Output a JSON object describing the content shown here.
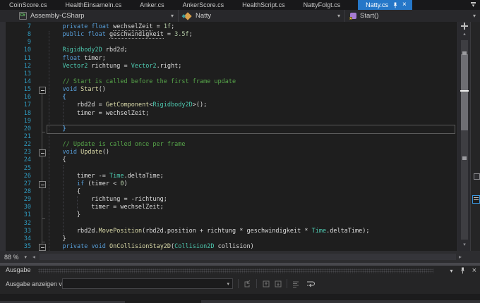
{
  "tabs": {
    "items": [
      {
        "label": "CoinScore.cs",
        "active": false
      },
      {
        "label": "HealthEinsameln.cs",
        "active": false
      },
      {
        "label": "Anker.cs",
        "active": false
      },
      {
        "label": "AnkerScore.cs",
        "active": false
      },
      {
        "label": "HealthScript.cs",
        "active": false
      },
      {
        "label": "NattyFolgt.cs",
        "active": false
      },
      {
        "label": "Natty.cs",
        "active": true
      }
    ],
    "active_tab_color": "#2577C8"
  },
  "navbar": {
    "project": "Assembly-CSharp",
    "type": "Natty",
    "member": "Start()"
  },
  "editor": {
    "zoom_level": "88 %",
    "language_colors": {
      "keyword": "#569CD6",
      "type": "#4EC9B0",
      "method": "#DCDCAA",
      "comment": "#57A64A",
      "number": "#B5CEA8",
      "plain": "#DCDCDC",
      "line_number": "#2F9BC0",
      "background": "#1E1E1E"
    },
    "lines": [
      {
        "n": 7,
        "s": [
          [
            "p",
            "    "
          ],
          [
            "k",
            "private"
          ],
          [
            "p",
            " "
          ],
          [
            "k",
            "float"
          ],
          [
            "p",
            " "
          ],
          [
            "w",
            "wechselZeit"
          ],
          [
            "p",
            " = "
          ],
          [
            "n",
            "1f"
          ],
          [
            "p",
            ";"
          ]
        ]
      },
      {
        "n": 8,
        "s": [
          [
            "p",
            "    "
          ],
          [
            "k",
            "public"
          ],
          [
            "p",
            " "
          ],
          [
            "k",
            "float"
          ],
          [
            "p",
            " "
          ],
          [
            "w",
            "geschwindigkeit"
          ],
          [
            "p",
            " = "
          ],
          [
            "n",
            "3.5f"
          ],
          [
            "p",
            ";"
          ]
        ]
      },
      {
        "n": 9,
        "s": []
      },
      {
        "n": 10,
        "s": [
          [
            "p",
            "    "
          ],
          [
            "t",
            "Rigidbody2D"
          ],
          [
            "p",
            " rbd2d;"
          ]
        ]
      },
      {
        "n": 11,
        "s": [
          [
            "p",
            "    "
          ],
          [
            "k",
            "float"
          ],
          [
            "p",
            " timer;"
          ]
        ]
      },
      {
        "n": 12,
        "s": [
          [
            "p",
            "    "
          ],
          [
            "t",
            "Vector2"
          ],
          [
            "p",
            " richtung = "
          ],
          [
            "t",
            "Vector2"
          ],
          [
            "p",
            ".right;"
          ]
        ]
      },
      {
        "n": 13,
        "s": []
      },
      {
        "n": 14,
        "s": [
          [
            "p",
            "    "
          ],
          [
            "c",
            "// Start is called before the first frame update"
          ]
        ]
      },
      {
        "n": 15,
        "fold": true,
        "s": [
          [
            "p",
            "    "
          ],
          [
            "k",
            "void"
          ],
          [
            "p",
            " "
          ],
          [
            "m",
            "Start"
          ],
          [
            "p",
            "()"
          ]
        ]
      },
      {
        "n": 16,
        "s": [
          [
            "p",
            "    "
          ],
          [
            "b",
            "{"
          ]
        ]
      },
      {
        "n": 17,
        "s": [
          [
            "p",
            "        rbd2d = "
          ],
          [
            "m",
            "GetComponent"
          ],
          [
            "p",
            "<"
          ],
          [
            "t",
            "Rigidbody2D"
          ],
          [
            "p",
            ">();"
          ]
        ]
      },
      {
        "n": 18,
        "s": [
          [
            "p",
            "        timer = wechselZeit;"
          ]
        ]
      },
      {
        "n": 19,
        "s": []
      },
      {
        "n": 20,
        "cur": true,
        "s": [
          [
            "p",
            "    "
          ],
          [
            "b",
            "}"
          ]
        ]
      },
      {
        "n": 21,
        "s": []
      },
      {
        "n": 22,
        "s": [
          [
            "p",
            "    "
          ],
          [
            "c",
            "// Update is called once per frame"
          ]
        ]
      },
      {
        "n": 23,
        "fold": true,
        "s": [
          [
            "p",
            "    "
          ],
          [
            "k",
            "void"
          ],
          [
            "p",
            " "
          ],
          [
            "m",
            "Update"
          ],
          [
            "p",
            "()"
          ]
        ]
      },
      {
        "n": 24,
        "s": [
          [
            "p",
            "    {"
          ]
        ]
      },
      {
        "n": 25,
        "s": []
      },
      {
        "n": 26,
        "s": [
          [
            "p",
            "        timer -= "
          ],
          [
            "t",
            "Time"
          ],
          [
            "p",
            ".deltaTime;"
          ]
        ]
      },
      {
        "n": 27,
        "fold": true,
        "s": [
          [
            "p",
            "        "
          ],
          [
            "k",
            "if"
          ],
          [
            "p",
            " (timer < "
          ],
          [
            "n",
            "0"
          ],
          [
            "p",
            ")"
          ]
        ]
      },
      {
        "n": 28,
        "s": [
          [
            "p",
            "        {"
          ]
        ]
      },
      {
        "n": 29,
        "s": [
          [
            "p",
            "            richtung = -richtung;"
          ]
        ]
      },
      {
        "n": 30,
        "s": [
          [
            "p",
            "            timer = wechselZeit;"
          ]
        ]
      },
      {
        "n": 31,
        "s": [
          [
            "p",
            "        }"
          ]
        ]
      },
      {
        "n": 32,
        "s": []
      },
      {
        "n": 33,
        "s": [
          [
            "p",
            "        rbd2d."
          ],
          [
            "m",
            "MovePosition"
          ],
          [
            "p",
            "(rbd2d.position + richtung * geschwindigkeit * "
          ],
          [
            "t",
            "Time"
          ],
          [
            "p",
            ".deltaTime);"
          ]
        ]
      },
      {
        "n": 34,
        "s": [
          [
            "p",
            "    }"
          ]
        ]
      },
      {
        "n": 35,
        "fold": true,
        "s": [
          [
            "p",
            "    "
          ],
          [
            "k",
            "private"
          ],
          [
            "p",
            " "
          ],
          [
            "k",
            "void"
          ],
          [
            "p",
            " "
          ],
          [
            "m",
            "OnCollisionStay2D"
          ],
          [
            "p",
            "("
          ],
          [
            "t",
            "Collision2D"
          ],
          [
            "p",
            " collision)"
          ]
        ]
      }
    ]
  },
  "output": {
    "title": "Ausgabe",
    "show_output_from_label": "Ausgabe anzeigen von:",
    "source_combo_value": "",
    "toolbar_icon_names": [
      "goto-source",
      "previous-message",
      "next-message",
      "clear-all",
      "toggle-word-wrap"
    ]
  },
  "icons": {
    "chevron_down": "▾",
    "close": "×",
    "scroll_up": "▴",
    "scroll_down": "▾",
    "scroll_left": "◂",
    "scroll_right": "▸"
  }
}
